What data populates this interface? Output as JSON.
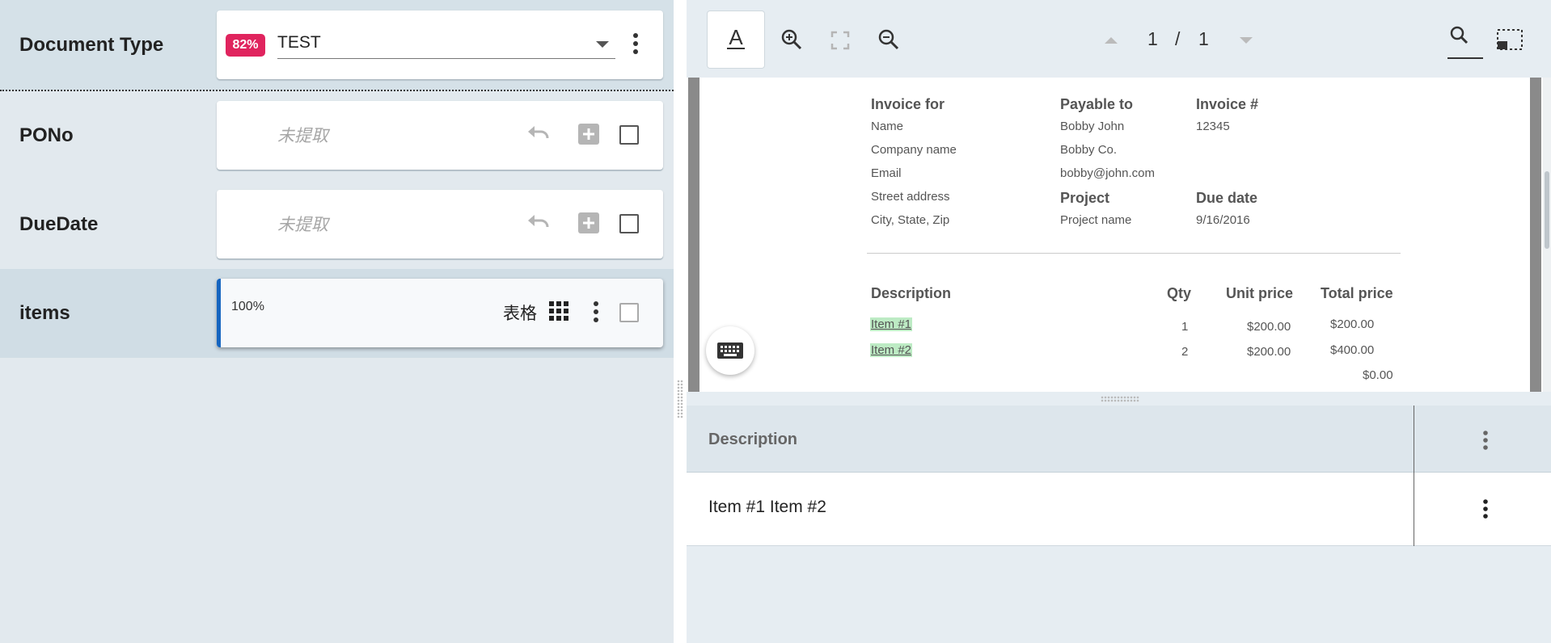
{
  "fields": {
    "doc_type": {
      "label": "Document Type",
      "confidence": "82%",
      "value": "TEST"
    },
    "pono": {
      "label": "PONo",
      "placeholder": "未提取"
    },
    "duedate": {
      "label": "DueDate",
      "placeholder": "未提取"
    },
    "items": {
      "label": "items",
      "confidence": "100%",
      "table_label": "表格"
    }
  },
  "toolbar": {
    "page_current": "1",
    "page_sep": "/",
    "page_total": "1",
    "text_mode_icon": "A"
  },
  "invoice": {
    "invoice_for_heading": "Invoice for",
    "invoice_for_lines": [
      "Name",
      "Company name",
      "Email",
      "Street address",
      "City, State, Zip"
    ],
    "payable_heading": "Payable to",
    "payable_lines": [
      "Bobby John",
      "Bobby Co.",
      "bobby@john.com"
    ],
    "project_heading": "Project",
    "project_value": "Project name",
    "invoice_no_heading": "Invoice #",
    "invoice_no_value": "12345",
    "due_heading": "Due date",
    "due_value": "9/16/2016",
    "columns": {
      "desc": "Description",
      "qty": "Qty",
      "unit": "Unit price",
      "total": "Total price"
    },
    "items": [
      {
        "desc": "Item #1",
        "qty": "1",
        "unit": "$200.00",
        "total": "$200.00"
      },
      {
        "desc": "Item #2",
        "qty": "2",
        "unit": "$200.00",
        "total": "$400.00"
      }
    ],
    "extra_total": "$0.00"
  },
  "table": {
    "header": "Description",
    "row_value": "Item #1 Item #2"
  },
  "colors": {
    "badge_red": "#e0245e",
    "accent_blue": "#1565c0",
    "highlight_green": "#bdebc4"
  }
}
